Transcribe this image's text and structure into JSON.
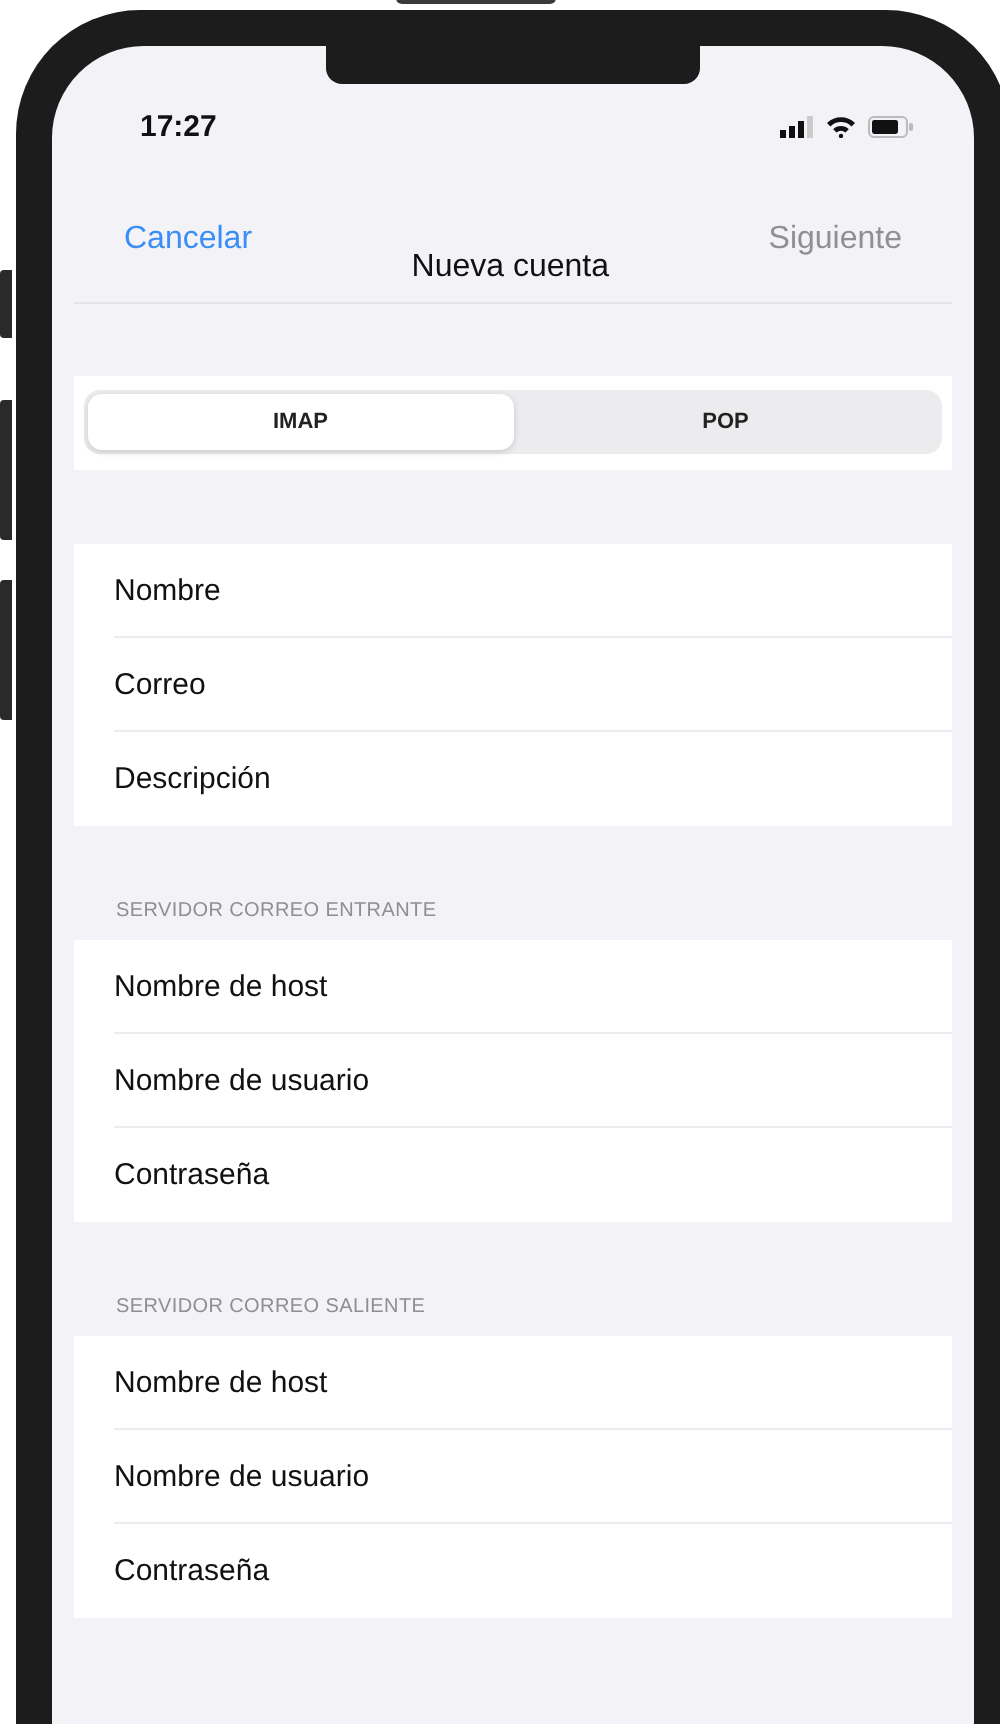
{
  "status_bar": {
    "time": "17:27"
  },
  "nav": {
    "cancel": "Cancelar",
    "title": "Nueva cuenta",
    "next": {
      "label": "Siguiente",
      "disabled": true
    }
  },
  "segments": [
    {
      "label": "IMAP",
      "selected": true
    },
    {
      "label": "POP",
      "selected": false
    }
  ],
  "sections": [
    {
      "fields": [
        "Nombre",
        "Correo",
        "Descripción"
      ]
    },
    {
      "header": "SERVIDOR CORREO ENTRANTE",
      "fields": [
        "Nombre de host",
        "Nombre de usuario",
        "Contraseña"
      ]
    },
    {
      "header": "SERVIDOR CORREO SALIENTE",
      "fields": [
        "Nombre de host",
        "Nombre de usuario",
        "Contraseña"
      ]
    }
  ]
}
